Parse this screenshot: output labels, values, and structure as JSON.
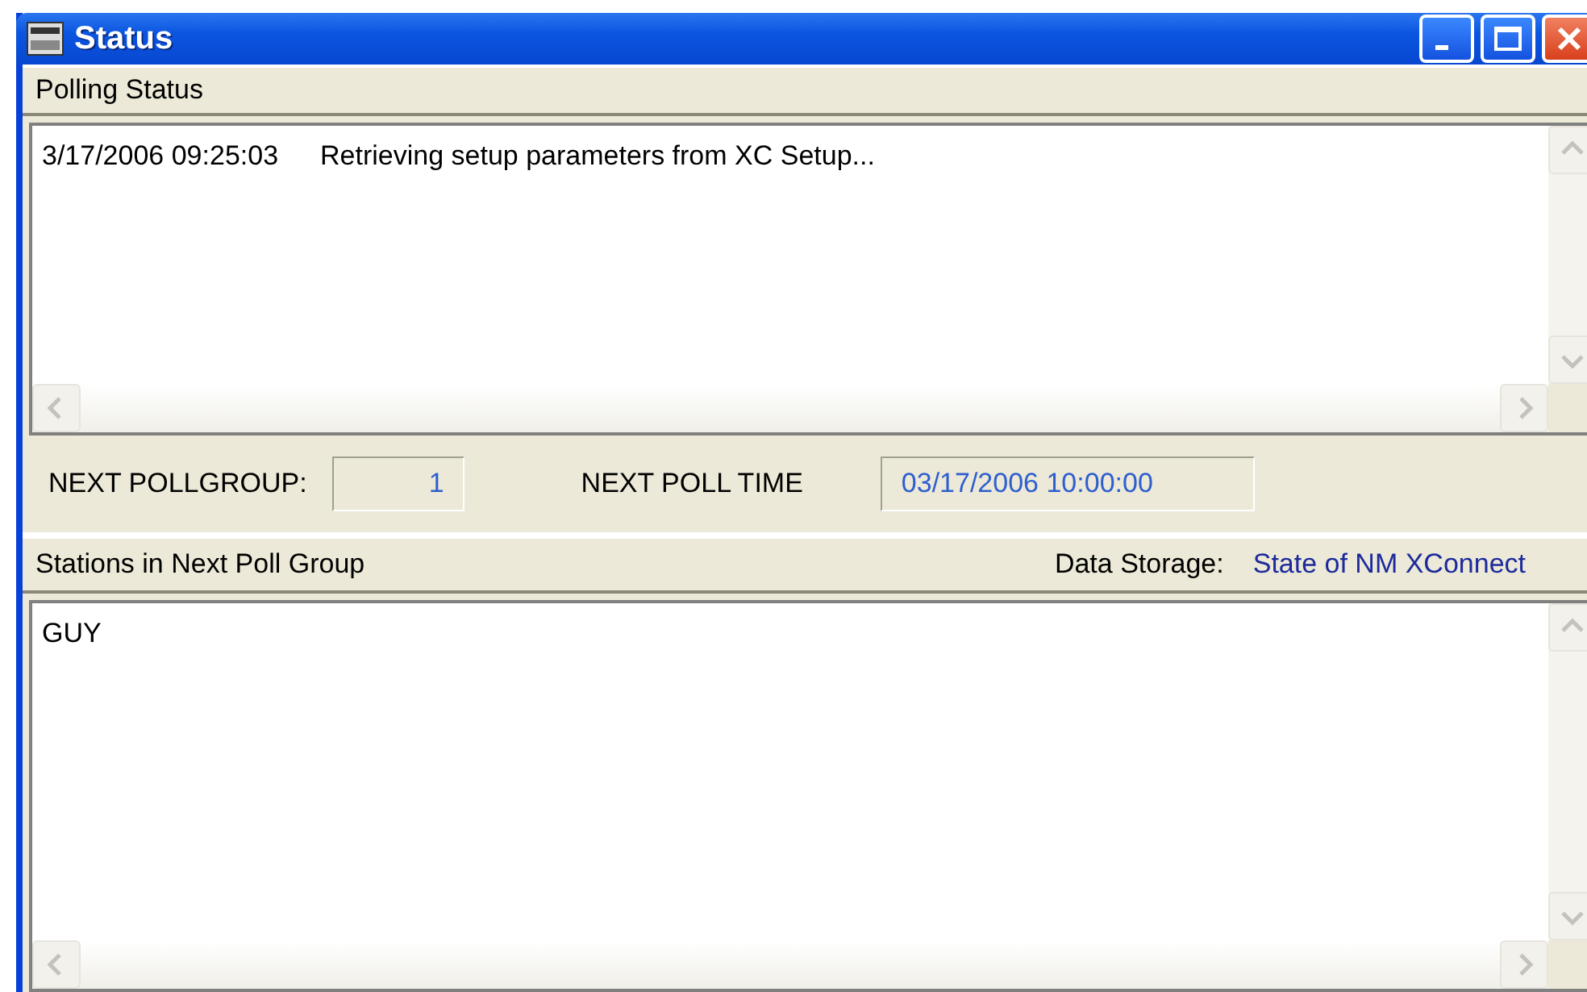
{
  "window": {
    "title": "Status"
  },
  "polling_status": {
    "label": "Polling Status",
    "entries": [
      {
        "time": "3/17/2006 09:25:03",
        "message": "Retrieving setup parameters from XC Setup..."
      }
    ]
  },
  "next_poll": {
    "group_label": "NEXT POLLGROUP:",
    "group_value": "1",
    "time_label": "NEXT POLL TIME",
    "time_value": "03/17/2006 10:00:00"
  },
  "stations": {
    "label": "Stations in Next Poll Group",
    "storage_label": "Data Storage:",
    "storage_value": "State of NM XConnect",
    "items": [
      "GUY"
    ]
  }
}
